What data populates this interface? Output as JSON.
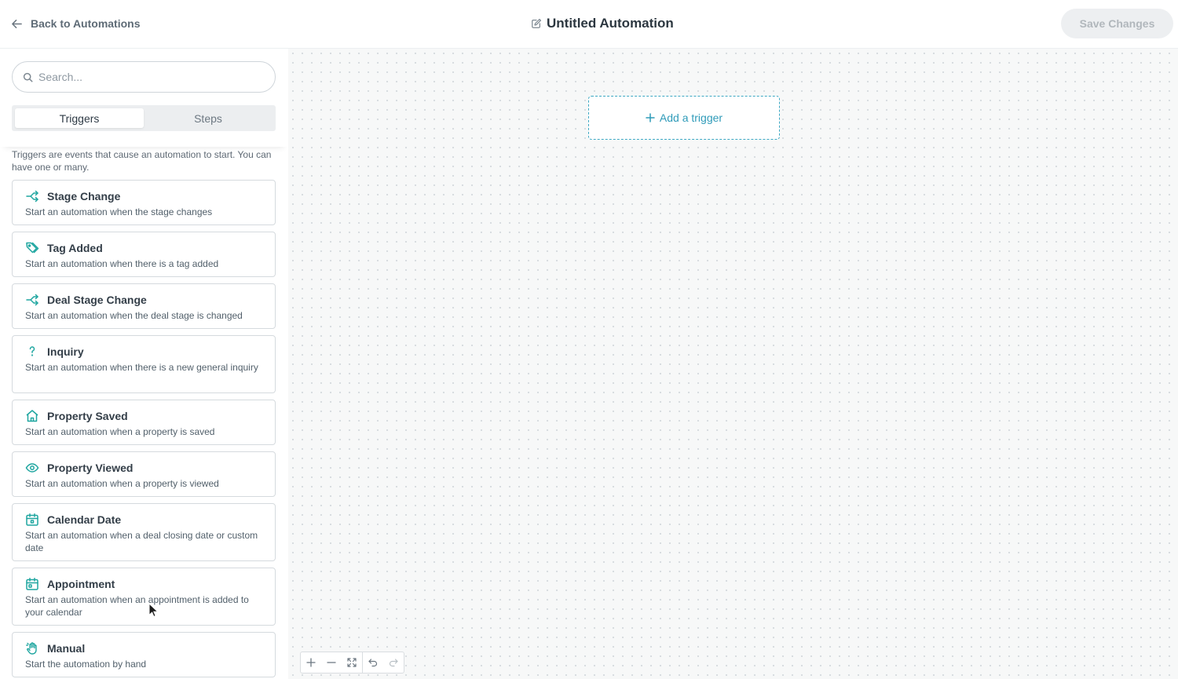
{
  "header": {
    "back_label": "Back to Automations",
    "title": "Untitled Automation",
    "save_label": "Save Changes"
  },
  "sidebar": {
    "search_placeholder": "Search...",
    "tabs": [
      {
        "label": "Triggers",
        "active": true
      },
      {
        "label": "Steps",
        "active": false
      }
    ],
    "description": "Triggers are events that cause an automation to start. You can have one or many.",
    "triggers": [
      {
        "icon": "branch-icon",
        "title": "Stage Change",
        "description": "Start an automation when the stage changes"
      },
      {
        "icon": "tag-icon",
        "title": "Tag Added",
        "description": "Start an automation when there is a tag added"
      },
      {
        "icon": "branch-icon",
        "title": "Deal Stage Change",
        "description": "Start an automation when the deal stage is changed"
      },
      {
        "icon": "question-icon",
        "title": "Inquiry",
        "description": "Start an automation when there is a new general inquiry"
      },
      {
        "icon": "house-icon",
        "title": "Property Saved",
        "description": "Start an automation when a property is saved"
      },
      {
        "icon": "eye-icon",
        "title": "Property Viewed",
        "description": "Start an automation when a property is viewed"
      },
      {
        "icon": "calendar-icon",
        "title": "Calendar Date",
        "description": "Start an automation when a deal closing date or custom date"
      },
      {
        "icon": "calendar-icon",
        "title": "Appointment",
        "description": "Start an automation when an appointment is added to your calendar"
      },
      {
        "icon": "hand-icon",
        "title": "Manual",
        "description": "Start the automation by hand"
      }
    ]
  },
  "canvas": {
    "add_trigger_label": "Add a trigger"
  },
  "colors": {
    "accent": "#2a9fb8",
    "icon_teal": "#1fa6a0",
    "save_disabled_bg": "#edeff1",
    "save_disabled_text": "#b1b7bc"
  }
}
